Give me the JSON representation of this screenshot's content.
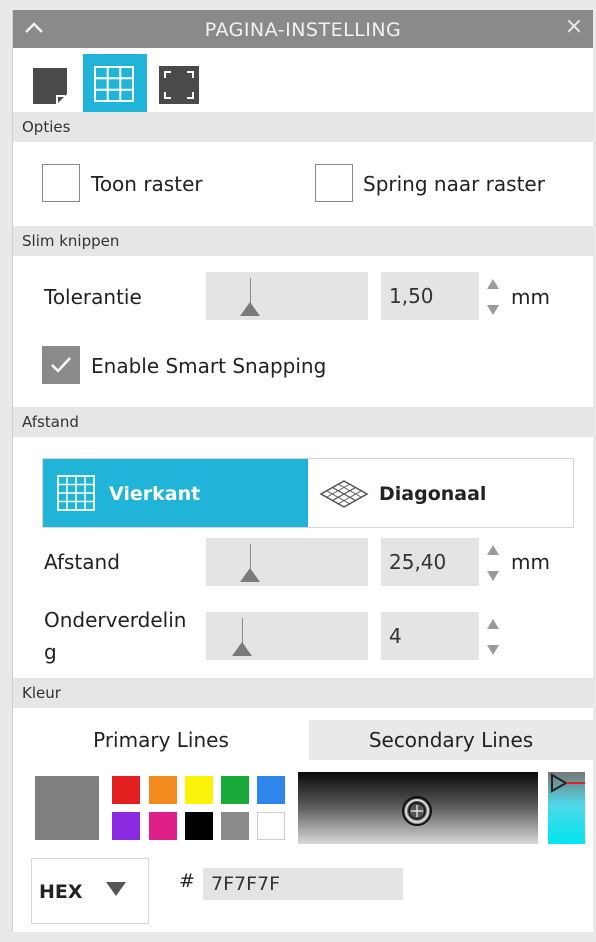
{
  "window": {
    "title": "PAGINA-INSTELLING"
  },
  "toolbar": {
    "icons": [
      "page-icon",
      "grid-icon",
      "frame-icon"
    ],
    "active": "grid-icon"
  },
  "sections": {
    "options": {
      "title": "Opties",
      "show_grid": {
        "label": "Toon raster",
        "checked": false
      },
      "snap_to_grid": {
        "label": "Spring naar raster",
        "checked": false
      }
    },
    "smart_cut": {
      "title": "Slim knippen",
      "tolerance": {
        "label": "Tolerantie",
        "value": "1,50",
        "unit": "mm"
      },
      "smart_snapping": {
        "label": "Enable Smart Snapping",
        "checked": true
      }
    },
    "spacing": {
      "title": "Afstand",
      "modes": {
        "square": "Vierkant",
        "diagonal": "Diagonaal",
        "selected": "Vierkant"
      },
      "distance": {
        "label": "Afstand",
        "value": "25,40",
        "unit": "mm"
      },
      "subdivision": {
        "label_line1": "Onderverdelin",
        "label_line2": "g",
        "value": "4"
      }
    },
    "color": {
      "title": "Kleur",
      "tabs": {
        "primary": "Primary Lines",
        "secondary": "Secondary Lines",
        "active": "Primary Lines"
      },
      "current_color": "#7F7F7F",
      "swatches_row1": [
        "#e32020",
        "#f28a1e",
        "#fbf40a",
        "#1aaa3a",
        "#2f86ea"
      ],
      "swatches_row2": [
        "#8a2be2",
        "#e0208a",
        "#000000",
        "#8a8a8a",
        "#ffffff"
      ],
      "format": "HEX",
      "hash": "#",
      "hex_value": "7F7F7F"
    }
  },
  "colors": {
    "accent": "#1fb4d8",
    "titlebar": "#8a8a8a",
    "section_bg": "#e6e6e6"
  }
}
